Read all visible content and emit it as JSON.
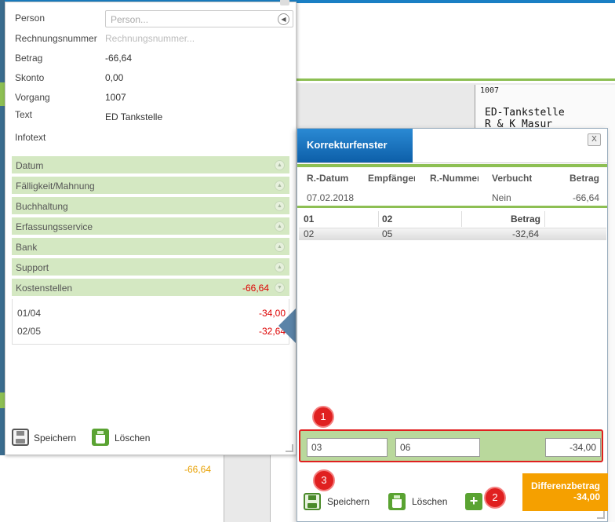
{
  "form": {
    "person": {
      "label": "Person",
      "placeholder": "Person..."
    },
    "rechnungsnummer": {
      "label": "Rechnungsnummer",
      "placeholder": "Rechnungsnummer..."
    },
    "betrag": {
      "label": "Betrag",
      "value": "-66,64"
    },
    "skonto": {
      "label": "Skonto",
      "value": "0,00"
    },
    "vorgang": {
      "label": "Vorgang",
      "value": "1007"
    },
    "text": {
      "label": "Text",
      "value": "ED Tankstelle"
    },
    "infotext": {
      "label": "Infotext"
    }
  },
  "sections": [
    {
      "label": "Datum"
    },
    {
      "label": "Fälligkeit/Mahnung"
    },
    {
      "label": "Buchhaltung"
    },
    {
      "label": "Erfassungsservice"
    },
    {
      "label": "Bank"
    },
    {
      "label": "Support"
    },
    {
      "label": "Kostenstellen",
      "amount": "-66,64"
    }
  ],
  "kostenstellen": [
    {
      "code": "01/04",
      "amount": "-34,00"
    },
    {
      "code": "02/05",
      "amount": "-32,64"
    }
  ],
  "left_footer": {
    "save_label": "Speichern",
    "delete_label": "Löschen"
  },
  "background": {
    "lower_value": "-66,64",
    "doc_number": "1007",
    "doc_lines": [
      "ED-Tankstelle",
      "R & K  Masur"
    ]
  },
  "correction": {
    "title": "Korrekturfenster",
    "close_label": "X",
    "headers": {
      "datum": "R.-Datum",
      "empfaenger": "Empfänger",
      "nummer": "R.-Nummer",
      "verbucht": "Verbucht",
      "betrag": "Betrag"
    },
    "row": {
      "datum": "07.02.2018",
      "empfaenger": "",
      "nummer": "",
      "verbucht": "Nein",
      "betrag": "-66,64"
    },
    "grid_headers": {
      "c1": "01",
      "c2": "02",
      "betrag": "Betrag"
    },
    "grid_rows": [
      {
        "c1": "02",
        "c2": "05",
        "betrag": "-32,64"
      }
    ],
    "edit": {
      "c1": "03",
      "c2": "06",
      "betrag": "-34,00"
    },
    "save_label": "Speichern",
    "delete_label": "Löschen",
    "plus_label": "+",
    "diff_label": "Differenzbetrag",
    "diff_value": "-34,00",
    "badges": [
      "1",
      "2",
      "3"
    ]
  },
  "colors": {
    "accent": "#1a7fc4",
    "section_bg": "#d4e8c2",
    "green": "#8dbf53",
    "negative": "#dd0000",
    "diff_bg": "#f5a000",
    "badge": "#e02020"
  }
}
